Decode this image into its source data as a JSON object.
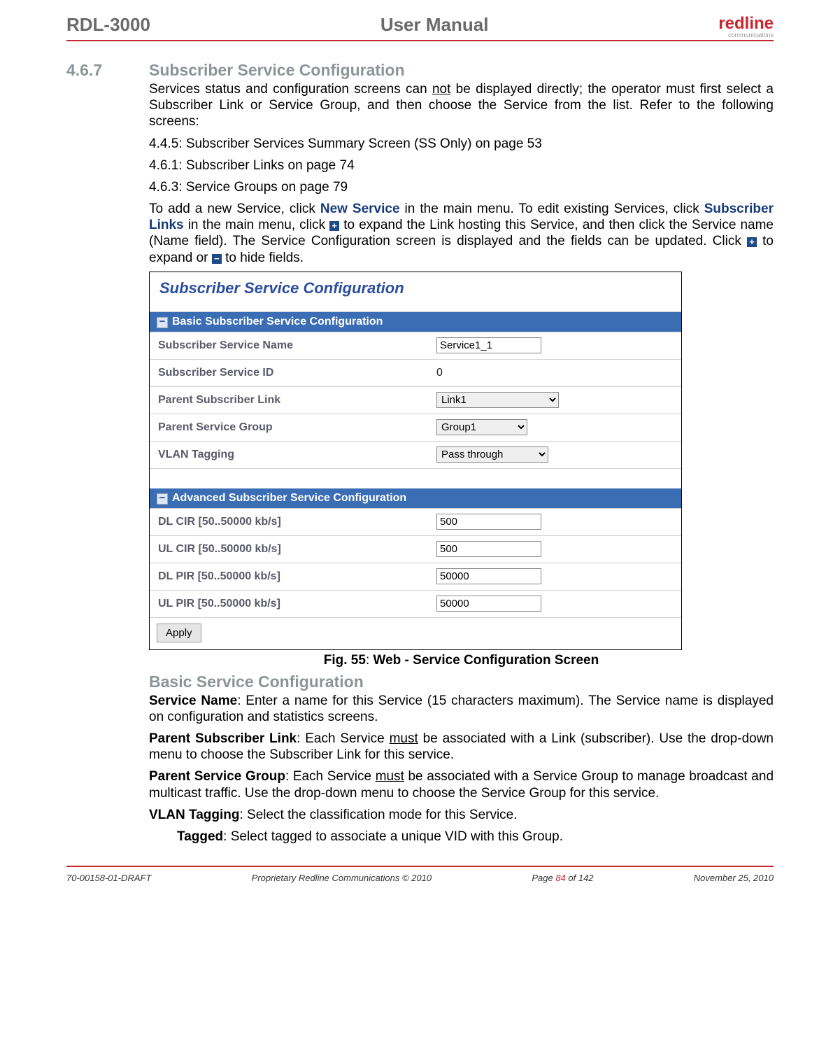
{
  "header": {
    "left": "RDL-3000",
    "center": "User Manual",
    "logo_main": "redline",
    "logo_sub": "communications"
  },
  "section": {
    "num": "4.6.7",
    "title": "Subscriber Service Configuration"
  },
  "para1a": "Services status and configuration screens can ",
  "para1_not": "not",
  "para1b": " be displayed directly; the operator must first select a Subscriber Link or Service Group, and then choose the Service from the list. Refer to the following screens:",
  "ref1": "4.4.5: Subscriber Services Summary Screen (SS Only) on page 53",
  "ref2": "4.6.1: Subscriber Links on page 74",
  "ref3": "4.6.3: Service Groups on page 79",
  "para2a": "To add a new Service, click ",
  "para2_newservice": "New Service",
  "para2b": " in the main menu. To edit existing Services, click ",
  "para2_sublinks": "Subscriber Links",
  "para2c": " in the main menu, click ",
  "para2d": " to expand the Link hosting this Service, and then click the Service name (Name field). The Service Configuration screen is displayed and the fields can be updated. Click ",
  "para2e": " to expand or ",
  "para2f": " to hide fields.",
  "screenshot": {
    "title": "Subscriber Service Configuration",
    "basic_header": "Basic Subscriber Service Configuration",
    "adv_header": "Advanced Subscriber Service Configuration",
    "rows_basic": [
      {
        "label": "Subscriber Service Name",
        "type": "input",
        "value": "Service1_1"
      },
      {
        "label": "Subscriber Service ID",
        "type": "text",
        "value": "0"
      },
      {
        "label": "Parent Subscriber Link",
        "type": "select",
        "value": "Link1",
        "cls": "w1"
      },
      {
        "label": "Parent Service Group",
        "type": "select",
        "value": "Group1",
        "cls": "w2"
      },
      {
        "label": "VLAN Tagging",
        "type": "select",
        "value": "Pass through",
        "cls": "w3"
      }
    ],
    "rows_adv": [
      {
        "label": "DL CIR [50..50000 kb/s]",
        "type": "input",
        "value": "500"
      },
      {
        "label": "UL CIR [50..50000 kb/s]",
        "type": "input",
        "value": "500"
      },
      {
        "label": "DL PIR [50..50000 kb/s]",
        "type": "input",
        "value": "50000"
      },
      {
        "label": "UL PIR [50..50000 kb/s]",
        "type": "input",
        "value": "50000"
      }
    ],
    "apply": "Apply"
  },
  "caption_a": "Fig. 55",
  "caption_b": ": ",
  "caption_c": "Web - Service Configuration Screen",
  "subhead": "Basic Service Configuration",
  "svc_name_lbl": "Service Name",
  "svc_name_txt": ": Enter a name for this Service (15 characters maximum). The Service name is displayed on configuration and statistics screens.",
  "parent_link_lbl": "Parent Subscriber Link",
  "parent_link_a": ": Each Service ",
  "parent_link_must": "must",
  "parent_link_b": " be associated with a Link (subscriber). Use the drop-down menu to choose the Subscriber Link for this service.",
  "parent_grp_lbl": "Parent Service Group",
  "parent_grp_a": ": Each Service ",
  "parent_grp_must": "must",
  "parent_grp_b": " be associated with a Service Group to manage broadcast and multicast traffic. Use the drop-down menu to choose the Service Group for this service.",
  "vlan_lbl": "VLAN Tagging",
  "vlan_txt": ": Select the classification mode for this Service.",
  "tagged_lbl": "Tagged",
  "tagged_txt": ": Select tagged to associate a unique VID with this Group.",
  "footer": {
    "left": "70-00158-01-DRAFT",
    "mid": "Proprietary Redline Communications © 2010",
    "page_a": "Page ",
    "page_num": "84",
    "page_b": " of 142",
    "date": "November 25, 2010"
  }
}
